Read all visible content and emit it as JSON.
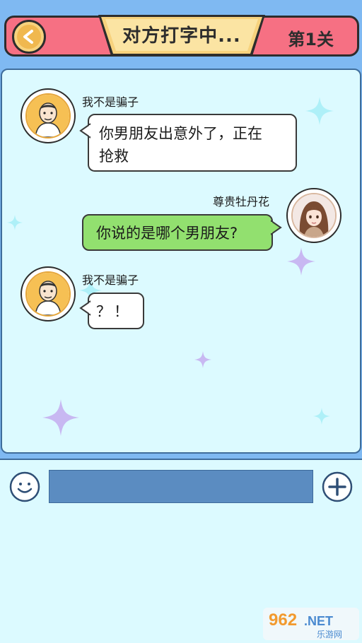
{
  "header": {
    "title": "对方打字中...",
    "level": "第1关",
    "back_icon": "back-arrow-icon"
  },
  "messages": [
    {
      "sender": "我不是骗子",
      "side": "left",
      "lines": [
        "你男朋友出意外了，正在",
        "抢救"
      ]
    },
    {
      "sender": "尊贵牡丹花",
      "side": "right",
      "lines": [
        "你说的是哪个男朋友?"
      ]
    },
    {
      "sender": "我不是骗子",
      "side": "left",
      "lines": [
        "？！"
      ]
    }
  ],
  "input": {
    "value": "",
    "emoji_icon": "smiley-icon",
    "plus_icon": "plus-icon"
  },
  "watermark": {
    "brand": "962.NET",
    "sub": "乐游网"
  },
  "colors": {
    "header_bg": "#f67083",
    "title_plate": "#f7d27d",
    "panel_bg": "#dcfaff",
    "page_bg": "#7fb9f2",
    "bubble_left": "#ffffff",
    "bubble_right": "#92e06f",
    "input_bg": "#5b8cc1"
  }
}
